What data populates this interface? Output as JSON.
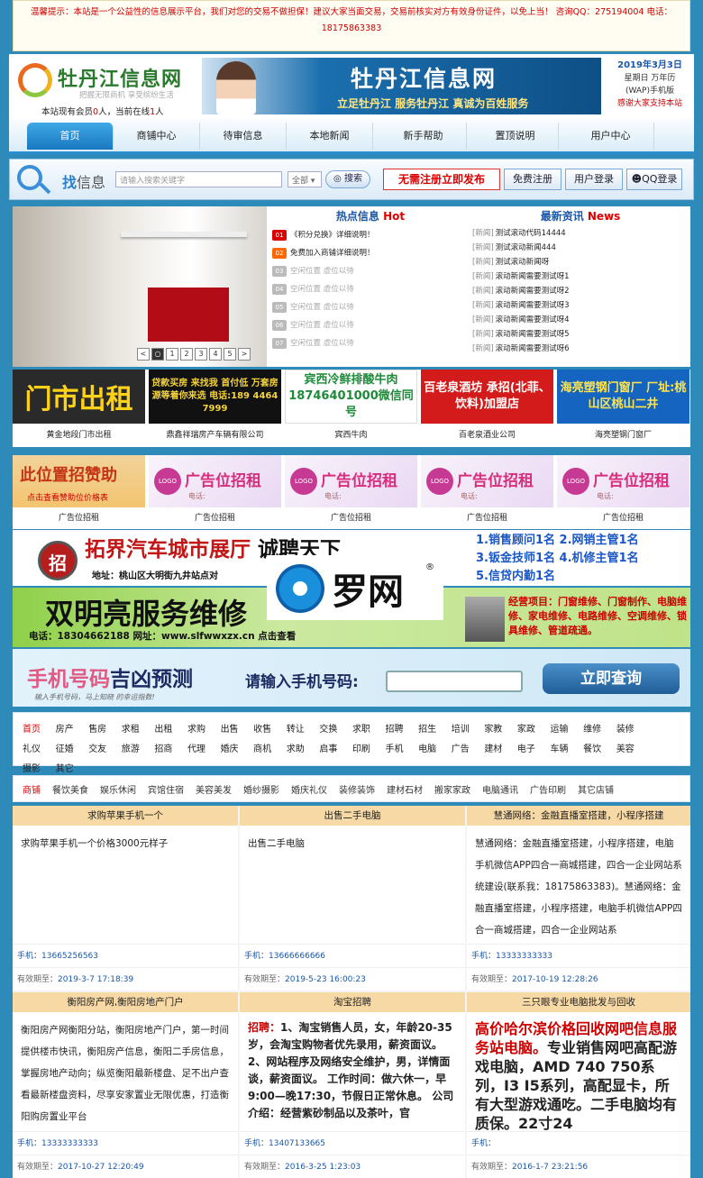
{
  "notice": {
    "text": "温馨提示：本站是一个公益性的信息展示平台，我们对您的交易不做担保！建议大家当面交易，交易前核实对方有效身份证件，以免上当！ 咨询QQ：275194004 电话：18175863383"
  },
  "header": {
    "logo_name": "牡丹江信息网",
    "logo_slogan": "把握无限商机 享受缤纷生活",
    "online_prefix": "本站现有会员",
    "members": "0",
    "online_mid": "人，当前在线",
    "online": "1",
    "online_suffix": "人",
    "banner_title": "牡丹江信息网",
    "banner_sub": "立足牡丹江 服务牡丹江 真诚为百姓服务",
    "date": "2019年3月3日",
    "weekday": "星期日 万年历",
    "wap": "(WAP)手机版",
    "thanks": "感谢大家支持本站"
  },
  "nav": [
    "首页",
    "商铺中心",
    "待审信息",
    "本地新闻",
    "新手帮助",
    "置顶说明",
    "用户中心"
  ],
  "search": {
    "label_a": "找",
    "label_b": "信息",
    "placeholder": "请输入搜索关键字",
    "scope": "全部",
    "button": "搜索",
    "publish": "无需注册立即发布",
    "register": "免费注册",
    "login": "用户登录",
    "qq_login": "QQ登录"
  },
  "slider": {
    "pages": [
      "1",
      "2",
      "3",
      "4",
      "5"
    ]
  },
  "hot": {
    "title": "热点信息",
    "title_en": "Hot",
    "items": [
      {
        "no": "01",
        "text": "《积分兑换》详细说明！"
      },
      {
        "no": "02",
        "text": "免费加入商铺详细说明！"
      },
      {
        "no": "03",
        "text": "空闲位置 虚位以待"
      },
      {
        "no": "04",
        "text": "空闲位置 虚位以待"
      },
      {
        "no": "05",
        "text": "空闲位置 虚位以待"
      },
      {
        "no": "06",
        "text": "空闲位置 虚位以待"
      },
      {
        "no": "07",
        "text": "空闲位置 虚位以待"
      }
    ]
  },
  "news": {
    "title": "最新资讯",
    "title_en": "News",
    "tag": "[新闻]",
    "items": [
      "测试滚动代码14444",
      "测试滚动新闻444",
      "测试滚动新闻呀",
      "滚动新闻需要测试呀1",
      "滚动新闻需要测试呀2",
      "滚动新闻需要测试呀3",
      "滚动新闻需要测试呀4",
      "滚动新闻需要测试呀5",
      "滚动新闻需要测试呀6"
    ]
  },
  "ads1": [
    {
      "img": "门市出租",
      "caption": "黄金地段门市出租",
      "bg": "#2a2a2a",
      "fg": "#ffd21a"
    },
    {
      "img": "贷款买房 来找我 首付低 万套房源等着你来选 电话:189 4464 7999",
      "caption": "鼎鑫祥瑞房产车辆有限公司",
      "bg": "#111111",
      "fg": "#f4d23b"
    },
    {
      "img": "宾西冷鲜排酸牛肉 18746401000微信同号",
      "caption": "宾西牛肉",
      "bg": "#ffffff",
      "fg": "#1f8a3a"
    },
    {
      "img": "百老泉酒坊 承招(北菲、饮料)加盟店",
      "caption": "百老泉酒业公司",
      "bg": "#d31b1b",
      "fg": "#ffffff"
    },
    {
      "img": "海亮塑钢门窗厂 厂址:桃山区桃山二井",
      "caption": "海亮塑钢门窗厂",
      "bg": "#1565c0",
      "fg": "#ffe44d"
    }
  ],
  "ads2": [
    {
      "title": "此位置招赞助",
      "tel": "点击查看赞助位价格表",
      "caption": "广告位招租"
    },
    {
      "title": "广告位招租",
      "logo": "LOGO",
      "tel": "电话:",
      "caption": "广告位招租"
    },
    {
      "title": "广告位招租",
      "logo": "LOGO",
      "tel": "电话:",
      "caption": "广告位招租"
    },
    {
      "title": "广告位招租",
      "logo": "LOGO",
      "tel": "电话:",
      "caption": "广告位招租"
    },
    {
      "title": "广告位招租",
      "logo": "LOGO",
      "tel": "电话:",
      "caption": "广告位招租"
    }
  ],
  "wide1": {
    "coin": "招",
    "headline": "拓界汽车城市展厅",
    "headline2": "诚聘天下",
    "addr": "地址：桃山区大明街九井站点对",
    "jobs": [
      "1.销售顾问1名 2.网销主管1名",
      "3.钣金技师1名 4.机修主管1名",
      "5.信贷内勤1名"
    ]
  },
  "watermark": {
    "text": "罗网",
    "reg": "®"
  },
  "wide2": {
    "headline": "双明亮服务维修",
    "contact": "电话：18304662188 网址：www.slfwwxzx.cn 点击查看",
    "biz": "经营项目：门窗维修、门窗制作、电脑维修、家电维修、电路维修、空调维修、锁具维修、管道疏通。"
  },
  "wide3": {
    "headline_a": "手机号码",
    "headline_b": "吉凶预测",
    "sub": "输入手机号码，马上知晓 的幸运指数!",
    "ask": "请输入手机号码:",
    "button": "立即查询"
  },
  "cats": [
    "首页",
    "房产",
    "售房",
    "求租",
    "出租",
    "求购",
    "出售",
    "收售",
    "转让",
    "交换",
    "求职",
    "招聘",
    "招生",
    "培训",
    "家教",
    "家政",
    "运输",
    "维修",
    "装修",
    "礼仪",
    "征婚",
    "交友",
    "旅游",
    "招商",
    "代理",
    "婚庆",
    "商机",
    "求助",
    "启事",
    "印刷",
    "手机",
    "电脑",
    "广告",
    "建材",
    "电子",
    "车辆",
    "餐饮",
    "美容",
    "摄影",
    "其它"
  ],
  "shop_tabs": [
    "商铺",
    "餐饮美食",
    "娱乐休闲",
    "宾馆住宿",
    "美容美发",
    "婚纱摄影",
    "婚庆礼仪",
    "装修装饰",
    "建材石材",
    "搬家家政",
    "电脑通讯",
    "广告印刷",
    "其它店铺"
  ],
  "cards": [
    {
      "title": "求购苹果手机一个",
      "body": "求购苹果手机一个价格3000元样子",
      "phone_label": "手机：",
      "phone": "13665256563",
      "exp_label": "有效期至：",
      "exp": "2019-3-7 17:18:39"
    },
    {
      "title": "出售二手电脑",
      "body": "出售二手电脑",
      "phone_label": "手机：",
      "phone": "13666666666",
      "exp_label": "有效期至：",
      "exp": "2019-5-23 16:00:23"
    },
    {
      "title": "慧通网络：金融直播室搭建，小程序搭建",
      "body": "慧通网络：金融直播室搭建，小程序搭建，电脑手机微信APP四合一商城搭建，四合一企业网站系统建设(联系我：18175863383)。慧通网络：金融直播室搭建，小程序搭建，电脑手机微信APP四合一商城搭建，四合一企业网站系",
      "phone_label": "手机：",
      "phone": "13333333333",
      "exp_label": "有效期至：",
      "exp": "2017-10-19 12:28:26"
    },
    {
      "title": "衡阳房产网,衡阳房地产门户",
      "body": "衡阳房产网衡阳分站，衡阳房地产门户，第一时间提供楼市快讯，衡阳房产信息，衡阳二手房信息，掌握房地产动向；纵览衡阳最新楼盘、足不出户查看最新楼盘资料，尽享安家置业无限优惠，打造衡阳购房置业平台",
      "phone_label": "手机：",
      "phone": "13333333333",
      "exp_label": "有效期至：",
      "exp": "2017-10-27 12:20:49"
    },
    {
      "title": "淘宝招聘",
      "body_head": "招聘：",
      "body": "1、淘宝销售人员，女，年龄20-35岁，会淘宝购物者优先录用，薪资面议。 2、网站程序及网络安全维护，男，详情面谈，薪资面议。 工作时间：做六休一，早9:00—晚17:30，节假日正常休息。 公司介绍：经营紫砂制品以及茶叶，官",
      "phone_label": "手机：",
      "phone": "13407133665",
      "exp_label": "有效期至：",
      "exp": "2016-3-25 1:23:03"
    },
    {
      "title": "三只眼专业电脑批发与回收",
      "body_head": "高价哈尔滨价格回收网吧信息服务站电脑。",
      "body": "专业销售网吧高配游戏电脑，AMD 740 750系列，I3 I5系列，高配显卡，所有大型游戏通吃。二手电脑均有质保。22寸24",
      "phone_label": "手机：",
      "phone": "",
      "exp_label": "有效期至：",
      "exp": "2016-1-7 23:21:56"
    }
  ]
}
